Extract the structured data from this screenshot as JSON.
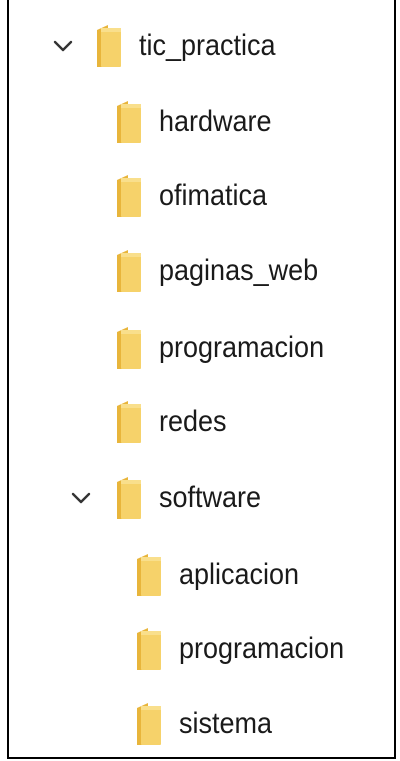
{
  "tree": {
    "root": {
      "label": "tic_practica",
      "expanded": true,
      "icon": "folder-icon",
      "children": [
        {
          "label": "hardware",
          "icon": "folder-icon"
        },
        {
          "label": "ofimatica",
          "icon": "folder-icon"
        },
        {
          "label": "paginas_web",
          "icon": "folder-icon"
        },
        {
          "label": "programacion",
          "icon": "folder-icon"
        },
        {
          "label": "redes",
          "icon": "folder-icon"
        },
        {
          "label": "software",
          "icon": "folder-icon",
          "expanded": true,
          "children": [
            {
              "label": "aplicacion",
              "icon": "folder-icon"
            },
            {
              "label": "programacion",
              "icon": "folder-icon"
            },
            {
              "label": "sistema",
              "icon": "folder-icon"
            }
          ]
        }
      ]
    }
  },
  "colors": {
    "folder_body": "#f6d26a",
    "folder_back": "#e8b53b",
    "chevron": "#333333",
    "text": "#1a1a1a"
  }
}
